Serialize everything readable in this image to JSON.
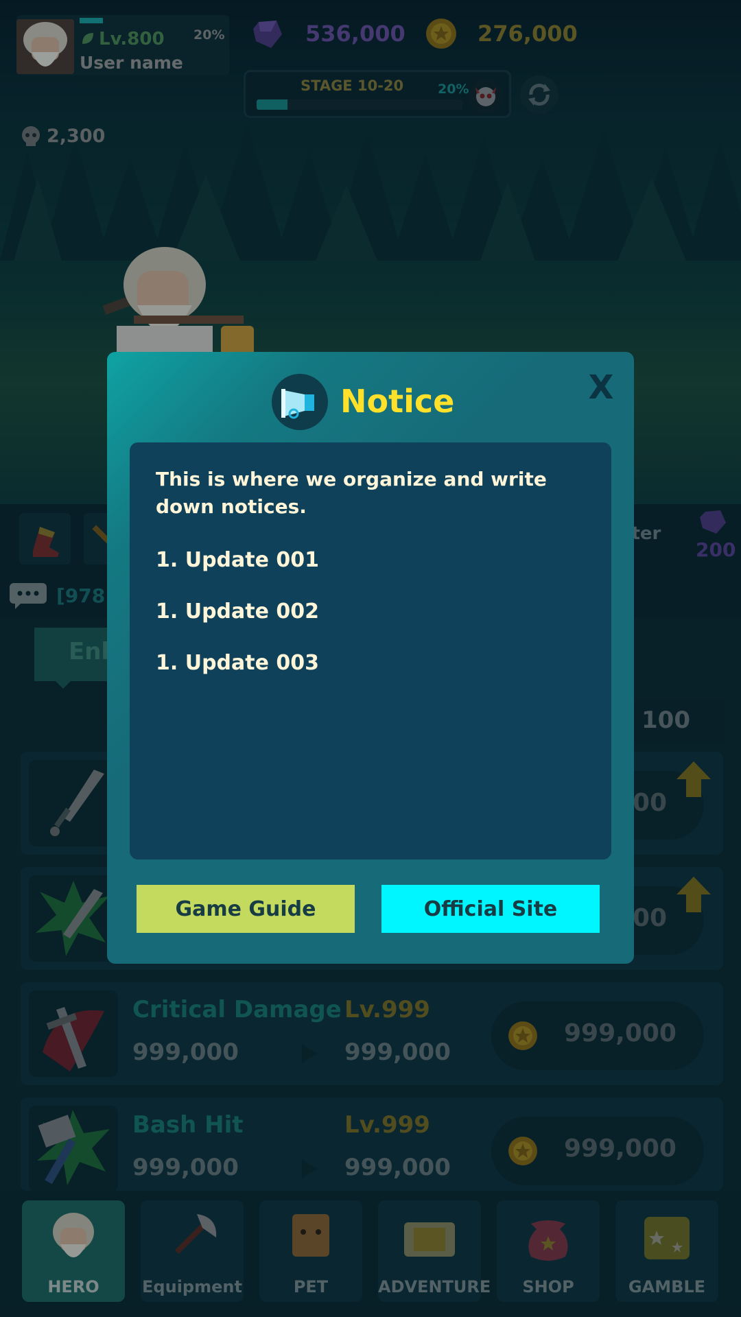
{
  "hud": {
    "level": "Lv.800",
    "xp_percent": "20%",
    "xp_progress": 0.2,
    "user_name": "User name",
    "gems": "536,000",
    "coins": "276,000",
    "stage_label": "STAGE 10-20",
    "stage_percent": "20%",
    "stage_progress": 0.15,
    "skulls": "2,300"
  },
  "booster": {
    "label": "ster",
    "gems": "200"
  },
  "chat": {
    "text": "[978"
  },
  "enhance_tab": {
    "label": "Enh"
  },
  "multiplier": "100",
  "upgrades": [
    {
      "name": "",
      "level": "",
      "current": "",
      "next": "",
      "cost": "00"
    },
    {
      "name": "",
      "level": "",
      "current": "",
      "next": "",
      "cost": "00"
    },
    {
      "name": "Critical Damage",
      "level": "Lv.999",
      "current": "999,000",
      "next": "999,000",
      "cost": "999,000"
    },
    {
      "name": "Bash Hit",
      "level": "Lv.999",
      "current": "999,000",
      "next": "999,000",
      "cost": "999,000"
    }
  ],
  "nav": [
    {
      "label": "HERO",
      "icon": "hero-icon",
      "active": true
    },
    {
      "label": "Equipment",
      "icon": "axe-icon",
      "active": false
    },
    {
      "label": "PET",
      "icon": "pet-icon",
      "active": false
    },
    {
      "label": "ADVENTURE",
      "icon": "map-icon",
      "active": false
    },
    {
      "label": "SHOP",
      "icon": "pouch-icon",
      "active": false
    },
    {
      "label": "GAMBLE",
      "icon": "dice-icon",
      "active": false
    }
  ],
  "notice": {
    "title": "Notice",
    "close_label": "X",
    "intro": "This is where we organize and write down notices.",
    "items": [
      "1. Update 001",
      "1. Update 002",
      "1. Update 003"
    ],
    "game_guide_label": "Game Guide",
    "official_site_label": "Official Site"
  },
  "colors": {
    "title_yellow": "#ffe02a",
    "guide_button": "#c3da5f",
    "site_button": "#00f6ff",
    "modal_bg": "#176a78",
    "body_bg": "#10415a"
  }
}
